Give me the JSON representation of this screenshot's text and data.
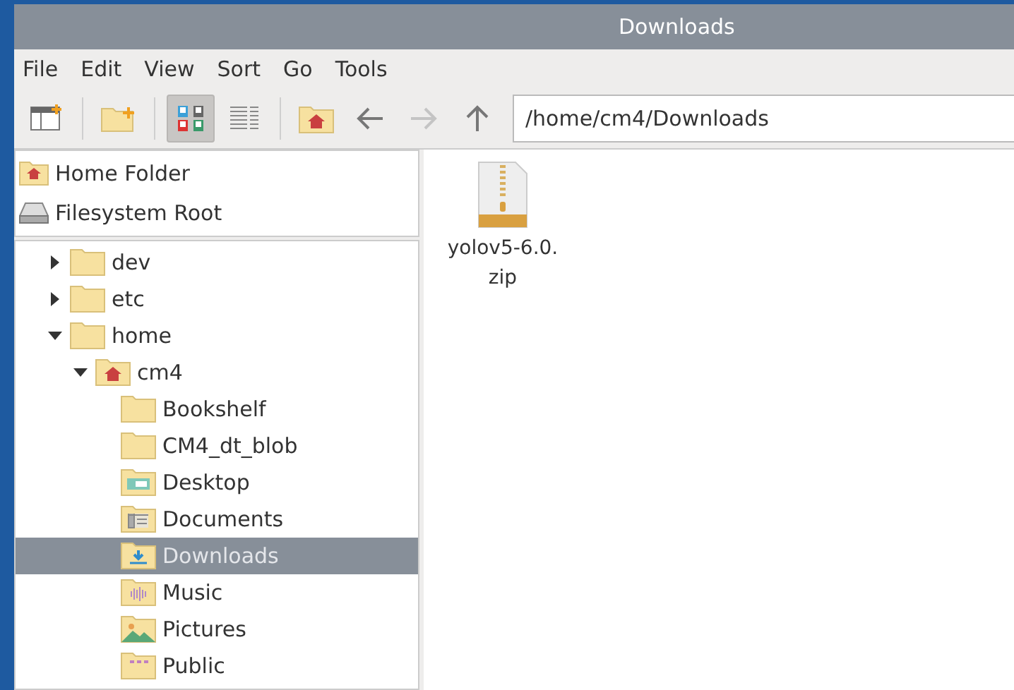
{
  "window": {
    "title": "Downloads"
  },
  "menu": [
    "File",
    "Edit",
    "View",
    "Sort",
    "Go",
    "Tools"
  ],
  "toolbar": [
    {
      "kind": "new-tab",
      "selected": false
    },
    {
      "kind": "new-folder",
      "selected": false
    },
    {
      "kind": "icon-view",
      "selected": true
    },
    {
      "kind": "list-view",
      "selected": false
    },
    {
      "kind": "home",
      "selected": false
    },
    {
      "kind": "back",
      "selected": false,
      "disabled": false
    },
    {
      "kind": "forward",
      "selected": false,
      "disabled": true
    },
    {
      "kind": "up",
      "selected": false,
      "disabled": false
    }
  ],
  "location": {
    "value": "/home/cm4/Downloads"
  },
  "places": [
    {
      "label": "Home Folder",
      "kind": "home"
    },
    {
      "label": "Filesystem Root",
      "kind": "drive"
    }
  ],
  "tree": [
    {
      "label": "dev",
      "kind": "folder",
      "expanded": false,
      "selected": false
    },
    {
      "label": "etc",
      "kind": "folder",
      "expanded": false,
      "selected": false
    },
    {
      "label": "home",
      "kind": "folder",
      "expanded": true,
      "selected": false,
      "children": [
        {
          "label": "cm4",
          "kind": "home",
          "expanded": true,
          "selected": false,
          "children": [
            {
              "label": "Bookshelf",
              "kind": "folder",
              "selected": false
            },
            {
              "label": "CM4_dt_blob",
              "kind": "folder",
              "selected": false
            },
            {
              "label": "Desktop",
              "kind": "desktop",
              "selected": false
            },
            {
              "label": "Documents",
              "kind": "documents",
              "selected": false
            },
            {
              "label": "Downloads",
              "kind": "downloads",
              "selected": true
            },
            {
              "label": "Music",
              "kind": "music",
              "selected": false
            },
            {
              "label": "Pictures",
              "kind": "pictures",
              "selected": false
            },
            {
              "label": "Public",
              "kind": "public",
              "selected": false
            }
          ]
        }
      ]
    }
  ],
  "files": [
    {
      "name": "yolov5-6.0.\nzip",
      "kind": "zip"
    }
  ]
}
